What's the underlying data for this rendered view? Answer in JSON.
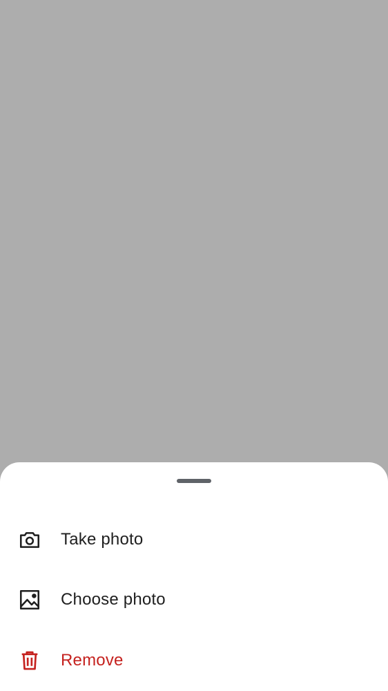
{
  "colors": {
    "scrim": "#adadad",
    "sheet_background": "#ffffff",
    "handle": "#5f6368",
    "text_default": "#1f1f1f",
    "text_destructive": "#c5221f"
  },
  "sheet": {
    "items": [
      {
        "label": "Take photo",
        "icon": "camera-icon",
        "color": "#1f1f1f"
      },
      {
        "label": "Choose photo",
        "icon": "image-icon",
        "color": "#1f1f1f"
      },
      {
        "label": "Remove",
        "icon": "trash-icon",
        "color": "#c5221f"
      }
    ]
  }
}
